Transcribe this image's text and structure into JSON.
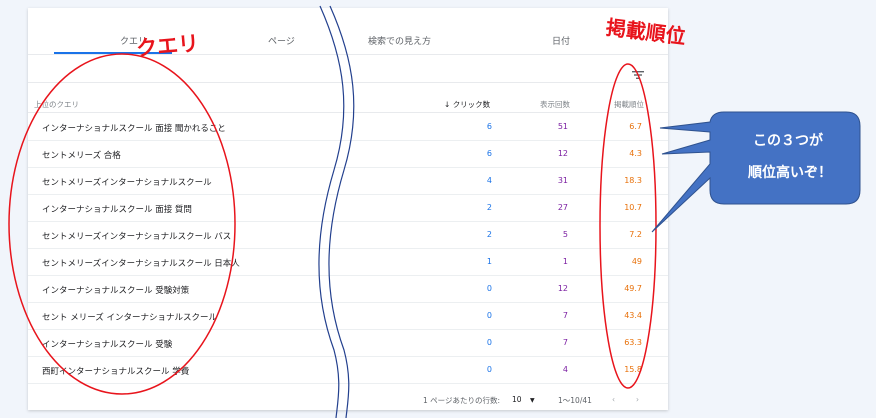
{
  "tabs": [
    "クエリ",
    "ページ",
    "検索での見え方",
    "日付"
  ],
  "columns": {
    "query": "上位のクエリ",
    "clicks": "クリック数",
    "impressions": "表示回数",
    "position": "掲載順位"
  },
  "rows": [
    {
      "query": "インターナショナルスクール 面接 聞かれること",
      "clicks": "6",
      "impressions": "51",
      "position": "6.7"
    },
    {
      "query": "セントメリーズ 合格",
      "clicks": "6",
      "impressions": "12",
      "position": "4.3"
    },
    {
      "query": "セントメリーズインターナショナルスクール",
      "clicks": "4",
      "impressions": "31",
      "position": "18.3"
    },
    {
      "query": "インターナショナルスクール 面接 質問",
      "clicks": "2",
      "impressions": "27",
      "position": "10.7"
    },
    {
      "query": "セントメリーズインターナショナルスクール バス",
      "clicks": "2",
      "impressions": "5",
      "position": "7.2"
    },
    {
      "query": "セントメリーズインターナショナルスクール 日本人",
      "clicks": "1",
      "impressions": "1",
      "position": "49"
    },
    {
      "query": "インターナショナルスクール 受験対策",
      "clicks": "0",
      "impressions": "12",
      "position": "49.7"
    },
    {
      "query": "セント メリーズ インターナショナルスクール",
      "clicks": "0",
      "impressions": "7",
      "position": "43.4"
    },
    {
      "query": "インターナショナルスクール 受験",
      "clicks": "0",
      "impressions": "7",
      "position": "63.3"
    },
    {
      "query": "西町インターナショナルスクール 学費",
      "clicks": "0",
      "impressions": "4",
      "position": "15.8"
    }
  ],
  "pagination": {
    "rows_per_page_label": "1 ページあたりの行数:",
    "rows_per_page_value": "10",
    "range": "1〜10/41"
  },
  "annotations": {
    "query_label": "クエリ",
    "position_label": "掲載順位",
    "callout_line1": "この３つが",
    "callout_line2": "順位高いぞ！"
  },
  "colors": {
    "clicks": "#1a73e8",
    "impressions": "#7b1fa2",
    "position": "#e8710a",
    "annotation_red": "#e8141c",
    "callout_fill": "#4472c4"
  }
}
